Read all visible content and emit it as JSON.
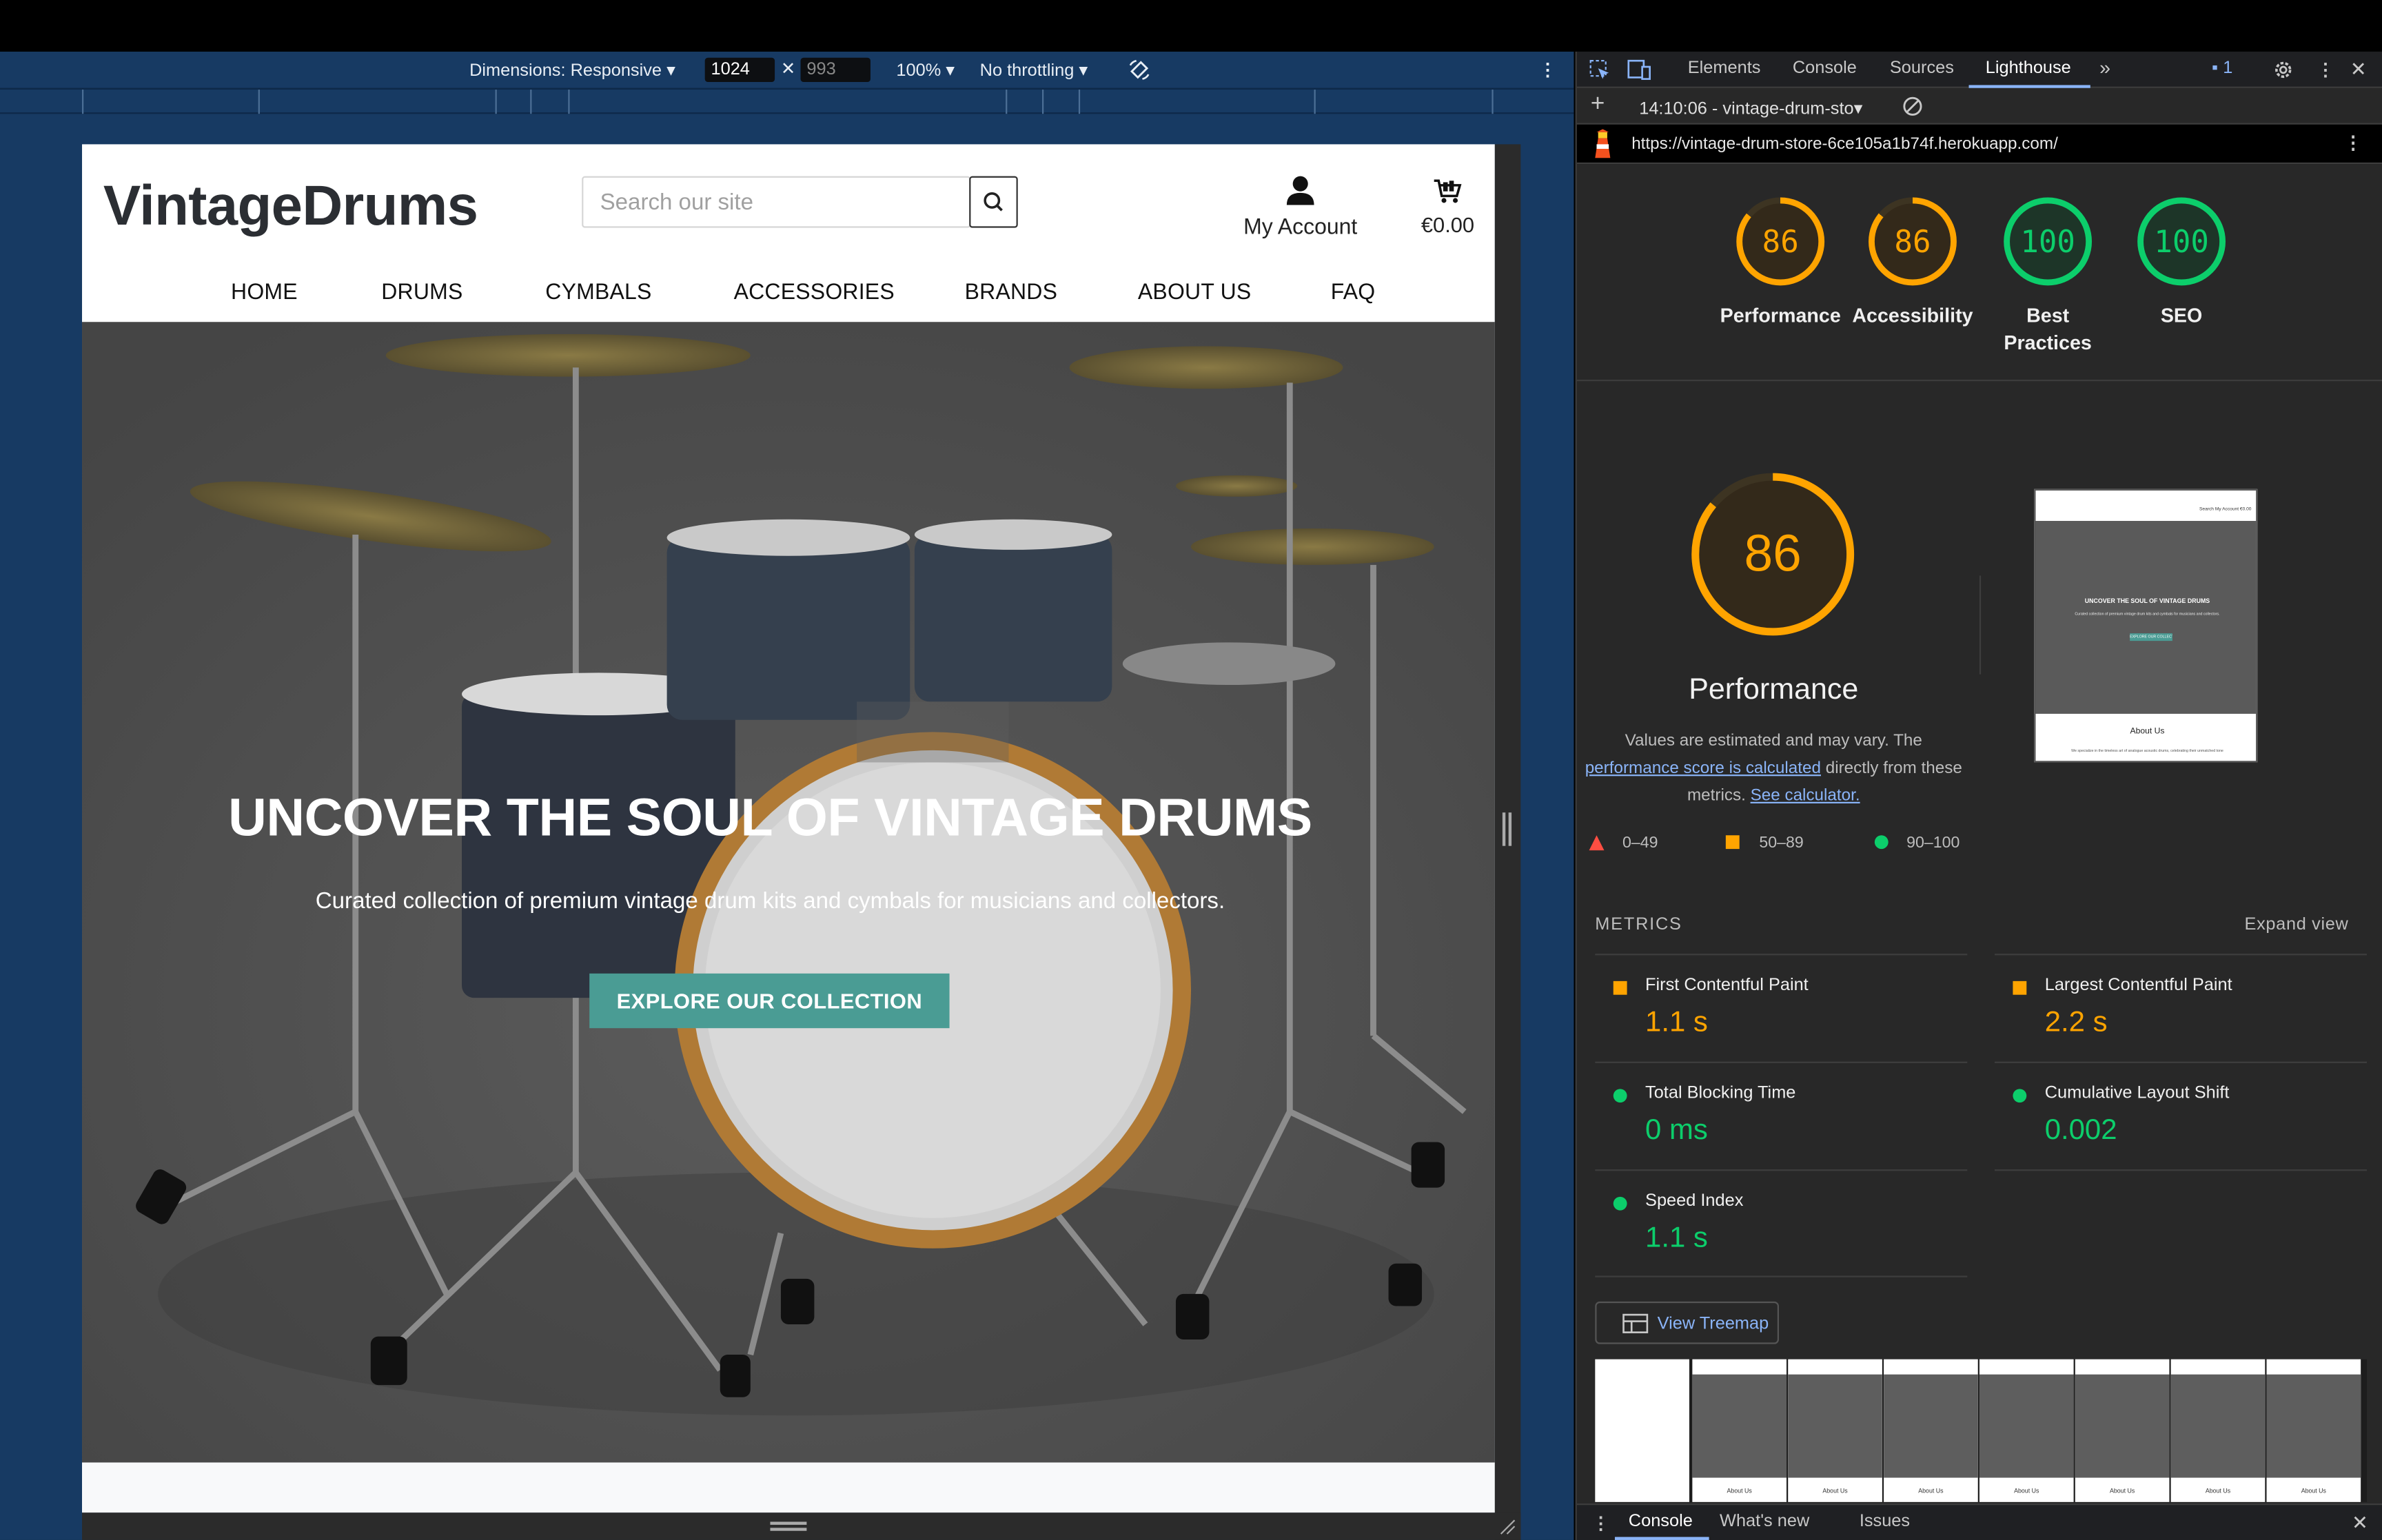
{
  "device_toolbar": {
    "dimensions_label": "Dimensions: Responsive",
    "width_value": "1024",
    "height_value": "993",
    "zoom": "100%",
    "throttling": "No throttling"
  },
  "site": {
    "logo": "VintageDrums",
    "search_placeholder": "Search our site",
    "account_label": "My Account",
    "cart_total": "€0.00",
    "nav": [
      "HOME",
      "DRUMS",
      "CYMBALS",
      "ACCESSORIES",
      "BRANDS",
      "ABOUT US",
      "FAQ"
    ],
    "hero_title": "UNCOVER THE SOUL OF VINTAGE DRUMS",
    "hero_subtitle": "Curated collection of premium vintage drum kits and cymbals for musicians and collectors.",
    "hero_button": "EXPLORE OUR COLLECTION"
  },
  "devtools": {
    "tabs": [
      "Elements",
      "Console",
      "Sources",
      "Lighthouse"
    ],
    "active_tab": "Lighthouse",
    "issues_count": "1",
    "report_select": "14:10:06 - vintage-drum-sto",
    "url": "https://vintage-drum-store-6ce105a1b74f.herokuapp.com/",
    "scores": [
      {
        "label": "Performance",
        "value": 86,
        "color": "#ffa400"
      },
      {
        "label": "Accessibility",
        "value": 86,
        "color": "#ffa400"
      },
      {
        "label": "Best Practices",
        "value": 100,
        "color": "#0cce6b"
      },
      {
        "label": "SEO",
        "value": 100,
        "color": "#0cce6b"
      }
    ],
    "performance": {
      "score": 86,
      "title": "Performance",
      "note_prefix": "Values are estimated and may vary. The",
      "note_link": "performance score is calculated",
      "note_mid": "directly from these metrics.",
      "note_link2": "See calculator."
    },
    "legend": [
      "0–49",
      "50–89",
      "90–100"
    ],
    "thumbnail": {
      "nav_items": [
        "Search",
        "My Account",
        "€0.00"
      ],
      "hero_title": "UNCOVER THE SOUL OF VINTAGE DRUMS",
      "hero_subtitle": "Curated collection of premium vintage drum kits and cymbals for musicians and collectors.",
      "hero_button": "EXPLORE OUR COLLECTION",
      "section_title": "About Us",
      "section_text": "We specialize in the timeless art of analogue acoustic drums, celebrating their unmatched tone"
    },
    "metrics_heading": "METRICS",
    "expand_label": "Expand view",
    "metrics": [
      {
        "name": "First Contentful Paint",
        "value": "1.1 s",
        "status": "average"
      },
      {
        "name": "Largest Contentful Paint",
        "value": "2.2 s",
        "status": "average"
      },
      {
        "name": "Total Blocking Time",
        "value": "0 ms",
        "status": "pass"
      },
      {
        "name": "Cumulative Layout Shift",
        "value": "0.002",
        "status": "pass"
      },
      {
        "name": "Speed Index",
        "value": "1.1 s",
        "status": "pass"
      }
    ],
    "treemap_label": "View Treemap",
    "filmstrip_caption": "About Us",
    "drawer_tabs": [
      "Console",
      "What's new",
      "Issues"
    ]
  }
}
